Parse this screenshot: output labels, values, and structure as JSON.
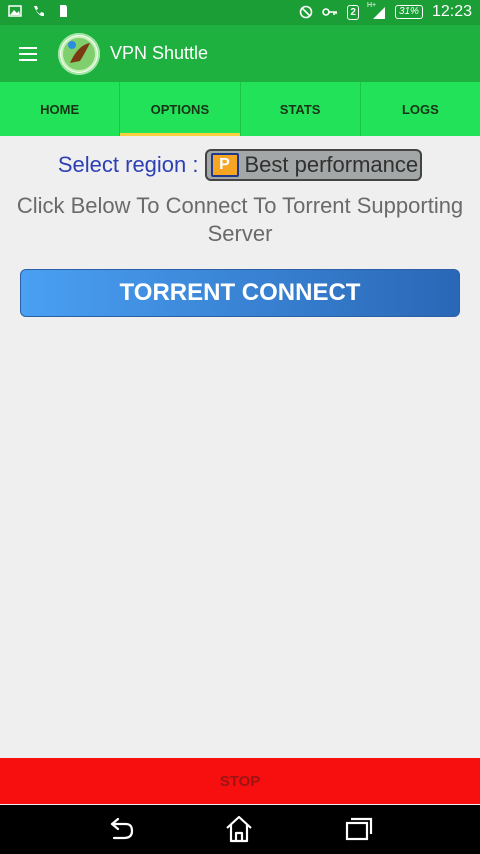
{
  "status_bar": {
    "sim_number": "2",
    "signal_label": "H+",
    "battery": "31%",
    "time": "12:23",
    "colors": {
      "bg": "#1a9e35"
    }
  },
  "app_bar": {
    "title": "VPN Shuttle",
    "menu_icon": "hamburger-menu-icon",
    "logo_icon": "vpn-shuttle-logo-icon"
  },
  "tabs": [
    {
      "label": "HOME",
      "active": false
    },
    {
      "label": "OPTIONS",
      "active": true
    },
    {
      "label": "STATS",
      "active": false
    },
    {
      "label": "LOGS",
      "active": false
    }
  ],
  "region": {
    "label": "Select region :",
    "selected": "Best performance",
    "flag_icon_letter": "P"
  },
  "hint_text": "Click Below To Connect To Torrent Supporting Server",
  "connect_button": "TORRENT CONNECT",
  "stop_button": "STOP",
  "nav": {
    "back_icon": "back-icon",
    "home_icon": "home-icon",
    "recent_icon": "recent-apps-icon"
  },
  "colors": {
    "app_bar": "#1fb13f",
    "tabs_bg": "#22e25a",
    "tab_indicator": "#f6d13d",
    "region_label": "#2c3fb3",
    "connect_gradient_start": "#4aa0f3",
    "connect_gradient_end": "#2a67b6",
    "stop_bg": "#f70f0f"
  }
}
